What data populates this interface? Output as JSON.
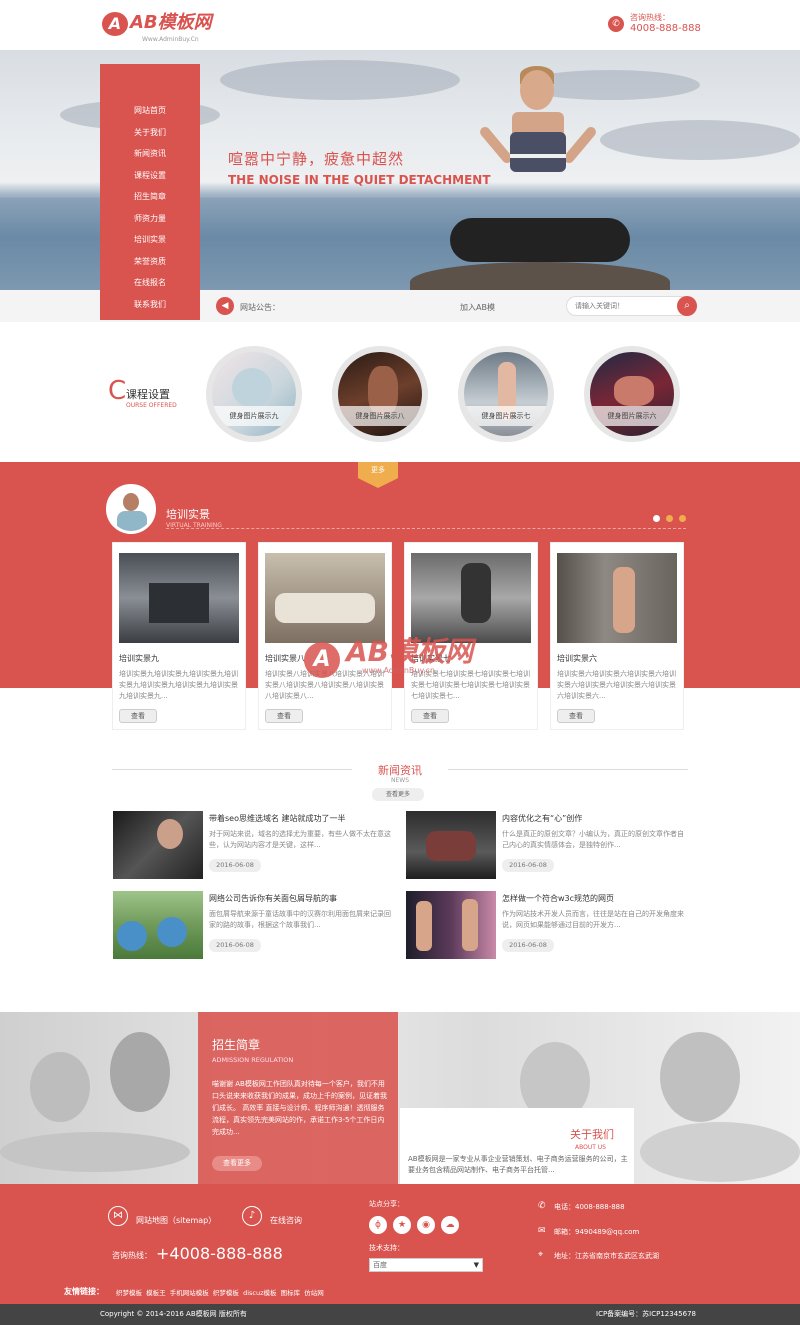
{
  "header": {
    "logo_mark": "A",
    "logo_name": "AB模板网",
    "logo_url": "Www.AdminBuy.Cn",
    "phone_label": "咨询热线：",
    "phone_number": "4008-888-888"
  },
  "nav": {
    "items": [
      "网站首页",
      "关于我们",
      "新闻资讯",
      "课程设置",
      "招生简章",
      "师资力量",
      "培训实景",
      "荣誉资质",
      "在线报名",
      "联系我们"
    ]
  },
  "banner": {
    "headline_cn": "喧嚣中宁静，疲惫中超然",
    "headline_en": "THE NOISE IN THE QUIET DETACHMENT"
  },
  "notice": {
    "label": "网站公告：",
    "text": "加入AB模",
    "search_placeholder": "请输入关键词！",
    "search_icon": "search-icon"
  },
  "courses": {
    "title_big": "C",
    "title_cn": "课程设置",
    "title_en": "OURSE OFFERED",
    "items": [
      {
        "caption": "健身图片展示九"
      },
      {
        "caption": "健身图片展示八"
      },
      {
        "caption": "健身图片展示七"
      },
      {
        "caption": "健身图片展示六"
      }
    ]
  },
  "training": {
    "tab_label": "更多",
    "title_cn": "培训实景",
    "title_en": "VIRTUAL TRAINING",
    "dot_colors": [
      "#ffffff",
      "#f0ad4e",
      "#f0ad4e"
    ],
    "items": [
      {
        "title": "培训实景九",
        "desc": "培训实景九培训实景九培训实景九培训实景九培训实景九培训实景九培训实景九培训实景九...",
        "more": "查看"
      },
      {
        "title": "培训实景八",
        "desc": "培训实景八培训实景八培训实景八培训实景八培训实景八培训实景八培训实景八培训实景八...",
        "more": "查看"
      },
      {
        "title": "培训实景七",
        "desc": "培训实景七培训实景七培训实景七培训实景七培训实景七培训实景七培训实景七培训实景七...",
        "more": "查看"
      },
      {
        "title": "培训实景六",
        "desc": "培训实景六培训实景六培训实景六培训实景六培训实景六培训实景六培训实景六培训实景六...",
        "more": "查看"
      }
    ],
    "watermark_mark": "A",
    "watermark_text": "AB模板网",
    "watermark_url": "www.AdminBuy.cn"
  },
  "news": {
    "title_cn": "新闻资讯",
    "title_en": "NEWS",
    "more": "查看更多",
    "items": [
      {
        "title": "带着seo思维选域名 建站就成功了一半",
        "text": "对于网站来说，域名的选择尤为重要，有些人做不太在意这些，认为网站内容才是关键，这样...",
        "date": "2016-06-08"
      },
      {
        "title": "内容优化之有“心”创作",
        "text": "什么是真正的原创文章？小编认为，真正的原创文章作者自己内心的真实情感体会，是独特创作...",
        "date": "2016-06-08"
      },
      {
        "title": "网络公司告诉你有关面包屑导航的事",
        "text": "面包屑导航来源于童话故事中的汉赛尔利用面包屑来记录回家的路的故事，根据这个故事我们...",
        "date": "2016-06-08"
      },
      {
        "title": "怎样做一个符合w3c规范的网页",
        "text": "作为网站技术开发人员而言，往往是站在自己的开发角度来说，网页如果能够通过目前的开发方...",
        "date": "2016-06-08"
      }
    ]
  },
  "admission": {
    "title_cn": "招生简章",
    "title_en": "ADMISSION REGULATION",
    "text": "喵谢谢 AB模板网工作团队真对待每一个客户，我们不用口头说来来收获我们的成果，成功上千的案例，见证着我们成长。 高效率 直接与设计师、程序师沟通！透彻服务流程，真实领先完美网站的作，承诺工作3-5个工作日内完成功...",
    "more": "查看更多"
  },
  "about": {
    "title_cn": "关于我们",
    "title_en": "ABOUT US",
    "text": "AB模板网是一家专业从事企业营销策划、电子商务运营服务的公司，主要业务包含精品网站制作、电子商务平台托管..."
  },
  "footer": {
    "sitemap": "网站地图（sitemap）",
    "online": "在线咨询",
    "hotline_label": "咨询热线：",
    "hotline_number": "+4008-888-888",
    "share_label": "站点分享：",
    "tech_label": "技术支持：",
    "tech_value": "百度",
    "phone": "电话：4008-888-888",
    "email": "邮箱：9490489@qq.com",
    "address": "地址：江苏省南京市玄武区玄武湖",
    "links_label": "友情链接：",
    "links": [
      "织梦模板",
      "模板王",
      "手机网站模板",
      "织梦模板",
      "discuz模板",
      "图标库",
      "仿站网"
    ],
    "social_icons": [
      "weibo-icon",
      "star-icon",
      "qq-icon",
      "wechat-icon"
    ]
  },
  "copyright": {
    "left": "Copyright © 2014-2016 AB模板网 版权所有",
    "right": "ICP备案编号：苏ICP12345678"
  },
  "colors": {
    "brand": "#d9534f",
    "accent": "#f0ad4e"
  }
}
